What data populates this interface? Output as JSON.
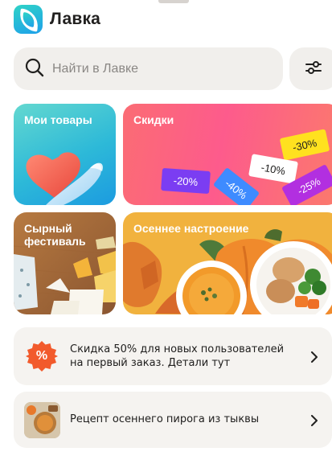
{
  "app": {
    "title": "Лавка"
  },
  "search": {
    "placeholder": "Найти в Лавке"
  },
  "tiles": {
    "my_items": {
      "title": "Мои товары"
    },
    "discounts": {
      "title": "Скидки",
      "tags": [
        "-30%",
        "-10%",
        "-20%",
        "-40%",
        "-25%"
      ]
    },
    "cheese": {
      "title_line1": "Сырный",
      "title_line2": "фестиваль"
    },
    "autumn": {
      "title": "Осеннее настроение"
    }
  },
  "banners": [
    {
      "line1": "Скидка 50% для новых пользователей",
      "line2": "на первый заказ. Детали тут",
      "badge": "%"
    },
    {
      "line1": "Рецепт осеннего пирога из тыквы"
    }
  ],
  "icons": {
    "search": "search-icon",
    "filter": "filter-sliders-icon",
    "chevron": "chevron-right-icon"
  },
  "colors": {
    "brand_gradient_start": "#2fd3c6",
    "brand_gradient_end": "#1ea0ea",
    "discount_badge": "#f25a2c"
  }
}
